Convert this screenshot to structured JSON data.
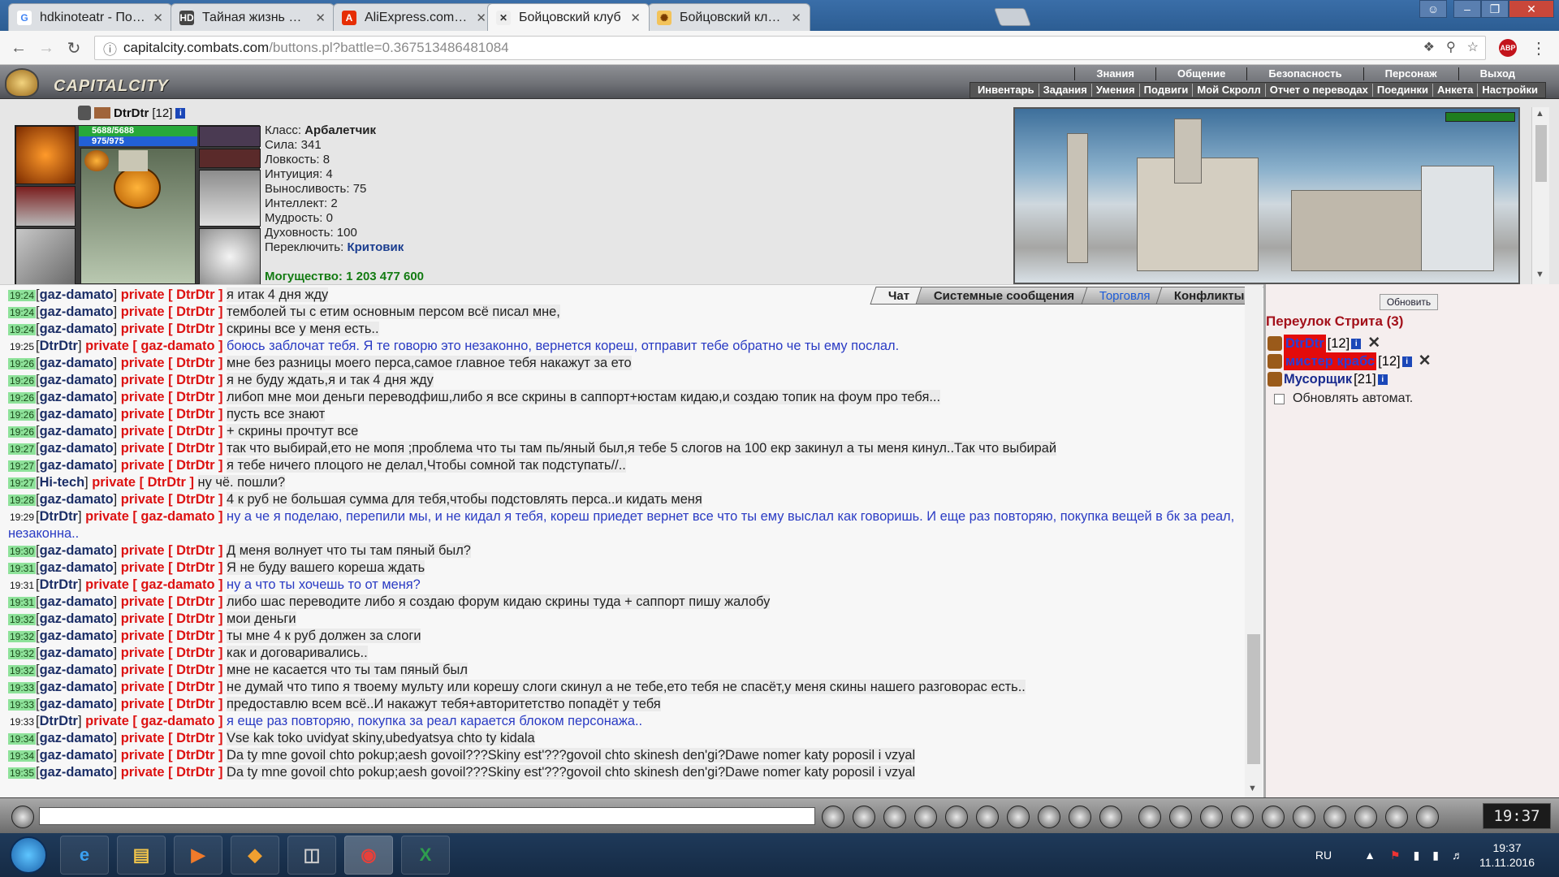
{
  "browser": {
    "tabs": [
      {
        "title": "hdkinoteatr - Поиск в Google",
        "favicon": "G",
        "active": false
      },
      {
        "title": "Тайная жизнь домашних",
        "favicon": "HD",
        "active": false
      },
      {
        "title": "AliExpress.com:My AliExpress",
        "favicon": "Ali",
        "active": false
      },
      {
        "title": "Бойцовский клуб",
        "favicon": "swords",
        "active": true
      },
      {
        "title": "Бойцовский клуб.",
        "favicon": "club",
        "active": false
      }
    ],
    "url_host": "capitalcity.combats.com",
    "url_path": "/buttons.pl?battle=0.367513486481084"
  },
  "game": {
    "logo": "CAPITALCITY",
    "menu_top": [
      "Знания",
      "Общение",
      "Безопасность",
      "Персонаж",
      "Выход"
    ],
    "menu_bottom": [
      "Инвентарь",
      "Задания",
      "Умения",
      "Подвиги",
      "Мой Скролл",
      "Отчет о переводах",
      "Поединки",
      "Анкета",
      "Настройки"
    ]
  },
  "character": {
    "name": "DtrDtr",
    "level": "[12]",
    "hp": "5688/5688",
    "mp": "975/975",
    "stats": [
      {
        "label": "Класс:",
        "value": "Арбалетчик",
        "bold": true
      },
      {
        "label": "Сила:",
        "value": "341"
      },
      {
        "label": "Ловкость:",
        "value": "8"
      },
      {
        "label": "Интуиция:",
        "value": "4"
      },
      {
        "label": "Выносливость:",
        "value": "75"
      },
      {
        "label": "Интеллект:",
        "value": "2"
      },
      {
        "label": "Мудрость:",
        "value": "0"
      },
      {
        "label": "Духовность:",
        "value": "100"
      },
      {
        "label": "Переключить:",
        "value": "Критовик",
        "link": true
      }
    ],
    "power": "Могущество: 1 203 477 600"
  },
  "chat": {
    "tabs": [
      {
        "label": "Чат",
        "active": true
      },
      {
        "label": "Системные сообщения"
      },
      {
        "label": "Торговля",
        "blue": true
      },
      {
        "label": "Конфликты"
      }
    ],
    "private_word": "private",
    "messages": [
      {
        "time": "19:24",
        "from": "gaz-damato",
        "to": "DtrDtr",
        "text": "я итак 4 дня жду"
      },
      {
        "time": "19:24",
        "from": "gaz-damato",
        "to": "DtrDtr",
        "text": "темболей ты с етим основным персом всё писал мне,"
      },
      {
        "time": "19:24",
        "from": "gaz-damato",
        "to": "DtrDtr",
        "text": "скрины все у меня есть.."
      },
      {
        "time": "19:25",
        "from": "DtrDtr",
        "to": "gaz-damato",
        "text": "боюсь заблочат тебя. Я те говорю это незаконно, вернется кореш, отправит тебе обратно че ты ему послал.",
        "mine": true
      },
      {
        "time": "19:26",
        "from": "gaz-damato",
        "to": "DtrDtr",
        "text": "мне без разницы моего перса,самое главное тебя накажут за ето"
      },
      {
        "time": "19:26",
        "from": "gaz-damato",
        "to": "DtrDtr",
        "text": "я не буду ждать,я и так 4 дня жду"
      },
      {
        "time": "19:26",
        "from": "gaz-damato",
        "to": "DtrDtr",
        "text": "либоп мне мои деньги переводфиш,либо я все скрины в саппорт+юстам кидаю,и создаю топик на фоум про тебя..."
      },
      {
        "time": "19:26",
        "from": "gaz-damato",
        "to": "DtrDtr",
        "text": "пусть все знают"
      },
      {
        "time": "19:26",
        "from": "gaz-damato",
        "to": "DtrDtr",
        "text": "+ скрины прочтут все"
      },
      {
        "time": "19:27",
        "from": "gaz-damato",
        "to": "DtrDtr",
        "text": "так что выбирай,ето не мопя ;проблема что ты там пь/яный был,я тебе 5 слогов на 100 екр закинул а ты меня кинул..Так что выбирай"
      },
      {
        "time": "19:27",
        "from": "gaz-damato",
        "to": "DtrDtr",
        "text": "я тебе ничего плоцого не делал,Чтобы сомной так подступать//.."
      },
      {
        "time": "19:27",
        "from": "Hi-tech",
        "to": "DtrDtr",
        "text": "ну чё. пошли?"
      },
      {
        "time": "19:28",
        "from": "gaz-damato",
        "to": "DtrDtr",
        "text": "4 к руб не большая сумма для тебя,чтобы подстовлять перса..и кидать меня"
      },
      {
        "time": "19:29",
        "from": "DtrDtr",
        "to": "gaz-damato",
        "text": "ну а че я поделаю, перепили мы, и не кидал я тебя, кореш приедет вернет все что ты ему выслал как говоришь. И еще раз повторяю, покупка вещей в бк за реал, незаконна..",
        "mine": true
      },
      {
        "time": "19:30",
        "from": "gaz-damato",
        "to": "DtrDtr",
        "text": "Д меня волнует что ты там пяный был?"
      },
      {
        "time": "19:31",
        "from": "gaz-damato",
        "to": "DtrDtr",
        "text": "Я не буду вашего кореша ждать"
      },
      {
        "time": "19:31",
        "from": "DtrDtr",
        "to": "gaz-damato",
        "text": "ну а что ты хочешь то от меня?",
        "mine": true
      },
      {
        "time": "19:31",
        "from": "gaz-damato",
        "to": "DtrDtr",
        "text": "либо шас переводите либо я создаю форум кидаю скрины туда + саппорт пишу жалобу"
      },
      {
        "time": "19:32",
        "from": "gaz-damato",
        "to": "DtrDtr",
        "text": "мои деньги"
      },
      {
        "time": "19:32",
        "from": "gaz-damato",
        "to": "DtrDtr",
        "text": "ты мне 4 к руб должен за слоги"
      },
      {
        "time": "19:32",
        "from": "gaz-damato",
        "to": "DtrDtr",
        "text": "как и договаривались.."
      },
      {
        "time": "19:32",
        "from": "gaz-damato",
        "to": "DtrDtr",
        "text": "мне не касается что ты там пяный был"
      },
      {
        "time": "19:33",
        "from": "gaz-damato",
        "to": "DtrDtr",
        "text": "не думай что типо я твоему мульту или корешу слоги скинул а не тебе,ето тебя не спасёт,у меня скины нашего разговорас есть.."
      },
      {
        "time": "19:33",
        "from": "gaz-damato",
        "to": "DtrDtr",
        "text": "предоставлю всем всё..И накажут тебя+авторитетство попадёт у тебя"
      },
      {
        "time": "19:33",
        "from": "DtrDtr",
        "to": "gaz-damato",
        "text": "я еще раз повторяю, покупка за реал карается блоком персонажа..",
        "mine": true
      },
      {
        "time": "19:34",
        "from": "gaz-damato",
        "to": "DtrDtr",
        "text": "Vse kak toko uvidyat skiny,ubedyatsya chto ty kidala"
      },
      {
        "time": "19:34",
        "from": "gaz-damato",
        "to": "DtrDtr",
        "text": "Da ty mne govoil chto pokup;aesh govoil???Skiny est'???govoil chto skinesh den'gi?Dawe nomer katy poposil i vzyal"
      },
      {
        "time": "19:35",
        "from": "gaz-damato",
        "to": "DtrDtr",
        "text": "Da ty mne govoil chto pokup;aesh govoil???Skiny est'???govoil chto skinesh den'gi?Dawe nomer katy poposil i vzyal"
      }
    ]
  },
  "room": {
    "refresh_label": "Обновить",
    "location": "Переулок Стрита (3)",
    "players": [
      {
        "name": "DtrDtr",
        "level": "[12]",
        "style": "red",
        "removable": true
      },
      {
        "name": "мистер крабс",
        "level": "[12]",
        "style": "red",
        "removable": true
      },
      {
        "name": "Мусорщик",
        "level": "[21]",
        "style": "blue",
        "removable": false
      }
    ],
    "auto_refresh_label": "Обновлять автомат."
  },
  "clock": "19:37",
  "taskbar": {
    "lang": "RU",
    "time": "19:37",
    "date": "11.11.2016"
  }
}
